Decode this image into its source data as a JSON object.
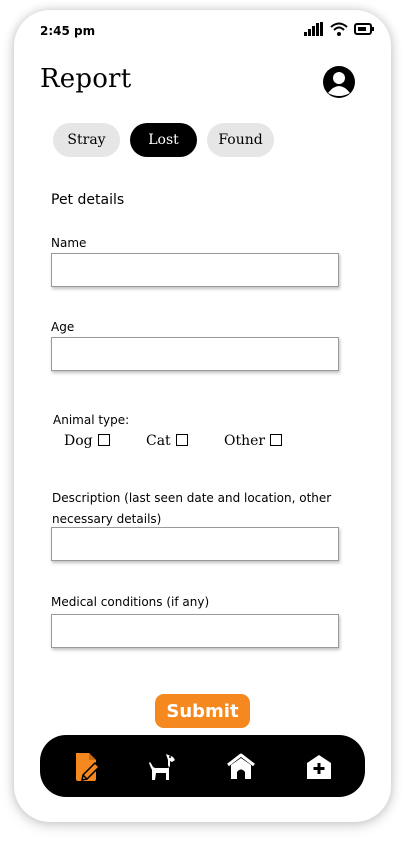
{
  "status_bar": {
    "time": "2:45 pm",
    "icons": [
      "signal-icon",
      "wifi-icon",
      "battery-icon"
    ]
  },
  "header": {
    "title": "Report",
    "avatar_icon": "user-avatar-icon"
  },
  "tabs": [
    {
      "label": "Stray",
      "active": false
    },
    {
      "label": "Lost",
      "active": true
    },
    {
      "label": "Found",
      "active": false
    }
  ],
  "form": {
    "section_title": "Pet details",
    "name": {
      "label": "Name",
      "value": "",
      "placeholder": ""
    },
    "age": {
      "label": "Age",
      "value": "",
      "placeholder": ""
    },
    "animal_type": {
      "label": "Animal type:",
      "options": [
        {
          "label": "Dog",
          "checked": false
        },
        {
          "label": "Cat",
          "checked": false
        },
        {
          "label": "Other",
          "checked": false
        }
      ]
    },
    "description": {
      "label": "Description (last seen date and location, other necessary details)",
      "value": "",
      "placeholder": ""
    },
    "medical": {
      "label": "Medical conditions (if any)",
      "value": "",
      "placeholder": ""
    },
    "submit_label": "Submit"
  },
  "bottom_nav": {
    "items": [
      {
        "icon": "report-document-icon",
        "active": true
      },
      {
        "icon": "dog-icon",
        "active": false
      },
      {
        "icon": "home-icon",
        "active": false
      },
      {
        "icon": "shelter-add-icon",
        "active": false
      }
    ]
  },
  "colors": {
    "accent": "#f5891f",
    "nav_bg": "#000000",
    "tab_inactive": "#e6e6e6",
    "tab_active": "#000000"
  }
}
